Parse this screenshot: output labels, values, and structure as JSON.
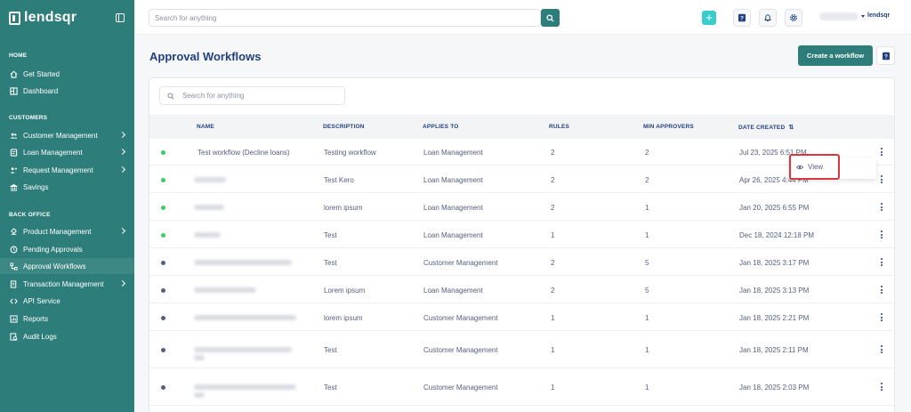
{
  "brand": {
    "name": "lendsqr"
  },
  "sidebar": {
    "sections": [
      {
        "title": "HOME"
      },
      {
        "title": "CUSTOMERS"
      },
      {
        "title": "BACK OFFICE"
      }
    ],
    "items": [
      {
        "label": "Get Started",
        "icon": "home-icon"
      },
      {
        "label": "Dashboard",
        "icon": "dashboard-icon"
      },
      {
        "label": "Customer Management",
        "icon": "users-icon",
        "has_submenu": true
      },
      {
        "label": "Loan Management",
        "icon": "loan-icon",
        "has_submenu": true
      },
      {
        "label": "Request Management",
        "icon": "request-icon",
        "has_submenu": true
      },
      {
        "label": "Savings",
        "icon": "savings-icon"
      },
      {
        "label": "Product Management",
        "icon": "product-icon",
        "has_submenu": true
      },
      {
        "label": "Pending Approvals",
        "icon": "clock-icon"
      },
      {
        "label": "Approval Workflows",
        "icon": "workflow-icon",
        "active": true
      },
      {
        "label": "Transaction Management",
        "icon": "transaction-icon",
        "has_submenu": true
      },
      {
        "label": "API Service",
        "icon": "api-icon"
      },
      {
        "label": "Reports",
        "icon": "reports-icon"
      },
      {
        "label": "Audit Logs",
        "icon": "audit-icon"
      }
    ]
  },
  "topbar": {
    "search_placeholder": "Search for anything",
    "org_brand": "lendsqr"
  },
  "page": {
    "title": "Approval Workflows",
    "create_button": "Create a workflow"
  },
  "table": {
    "search_placeholder": "Search for anything",
    "columns": [
      "NAME",
      "DESCRIPTION",
      "APPLIES TO",
      "RULES",
      "MIN APPROVERS",
      "DATE CREATED"
    ],
    "rows": [
      {
        "name": "Test workflow (Decline loans)",
        "description": "Testing workflow",
        "applies_to": "Loan Management",
        "rules": "2",
        "min_approvers": "2",
        "date": "Jul 23, 2025 6:51 PM",
        "status": "active"
      },
      {
        "name": "",
        "description": "Test Kero",
        "applies_to": "Loan Management",
        "rules": "2",
        "min_approvers": "2",
        "date": "Apr 26, 2025 4:44 PM",
        "status": "active"
      },
      {
        "name": "",
        "description": "lorem ipsum",
        "applies_to": "Loan Management",
        "rules": "2",
        "min_approvers": "1",
        "date": "Jan 20, 2025 6:55 PM",
        "status": "active"
      },
      {
        "name": "",
        "description": "Test",
        "applies_to": "Loan Management",
        "rules": "1",
        "min_approvers": "1",
        "date": "Dec 18, 2024 12:18 PM",
        "status": "active"
      },
      {
        "name": "",
        "description": "Test",
        "applies_to": "Customer Management",
        "rules": "2",
        "min_approvers": "5",
        "date": "Jan 18, 2025 3:17 PM",
        "status": "inactive"
      },
      {
        "name": "",
        "description": "Lorem ipsum",
        "applies_to": "Loan Management",
        "rules": "2",
        "min_approvers": "5",
        "date": "Jan 18, 2025 3:13 PM",
        "status": "inactive"
      },
      {
        "name": "",
        "description": "lorem ipsum",
        "applies_to": "Customer Management",
        "rules": "1",
        "min_approvers": "1",
        "date": "Jan 18, 2025 2:21 PM",
        "status": "inactive"
      },
      {
        "name": "",
        "description": "Test",
        "applies_to": "Customer Management",
        "rules": "1",
        "min_approvers": "1",
        "date": "Jan 18, 2025 2:11 PM",
        "status": "inactive"
      },
      {
        "name": "",
        "description": "Test",
        "applies_to": "Customer Management",
        "rules": "1",
        "min_approvers": "1",
        "date": "Jan 18, 2025 2:03 PM",
        "status": "inactive"
      }
    ]
  },
  "popover": {
    "view_label": "View"
  },
  "colors": {
    "primary": "#2d7d7a",
    "navy": "#213f7d",
    "active_dot": "#39cd62",
    "inactive_dot": "#545f7d",
    "highlight": "#d9363e"
  }
}
